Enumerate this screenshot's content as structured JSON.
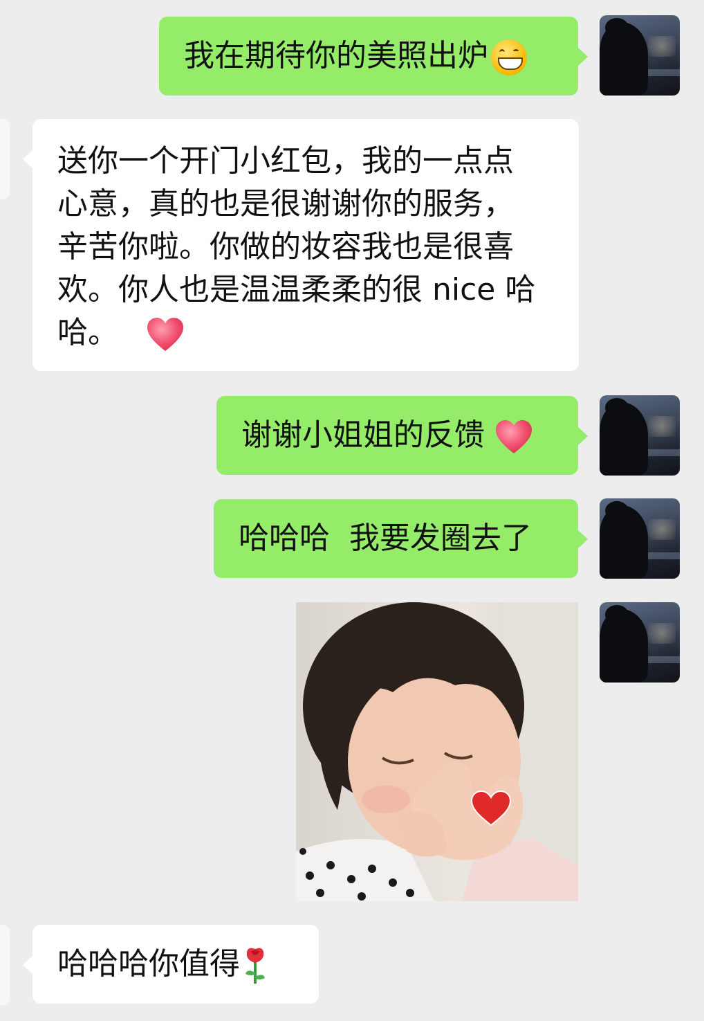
{
  "messages": [
    {
      "side": "me",
      "text": "我在期待你的美照出炉",
      "emoji": "grinning-face"
    },
    {
      "side": "other",
      "lines": [
        "送你一个开门小红包，我的一点点",
        "心意，真的也是很谢谢你的服务，",
        "辛苦你啦。你做的妆容我也是很喜",
        "欢。你人也是温温柔柔的很 nice 哈",
        "哈。"
      ],
      "emoji": "red-heart"
    },
    {
      "side": "me",
      "text": "谢谢小姐姐的反馈",
      "emoji": "red-heart"
    },
    {
      "side": "me",
      "text": "哈哈哈  我要发圈去了"
    },
    {
      "side": "me",
      "type": "image",
      "description_icon": "sticker-photo"
    },
    {
      "side": "other",
      "text": "哈哈哈你值得",
      "emoji": "rose"
    }
  ],
  "colors": {
    "background": "#ededed",
    "my_bubble": "#95ec69",
    "other_bubble": "#ffffff",
    "heart": "#f0506e"
  }
}
